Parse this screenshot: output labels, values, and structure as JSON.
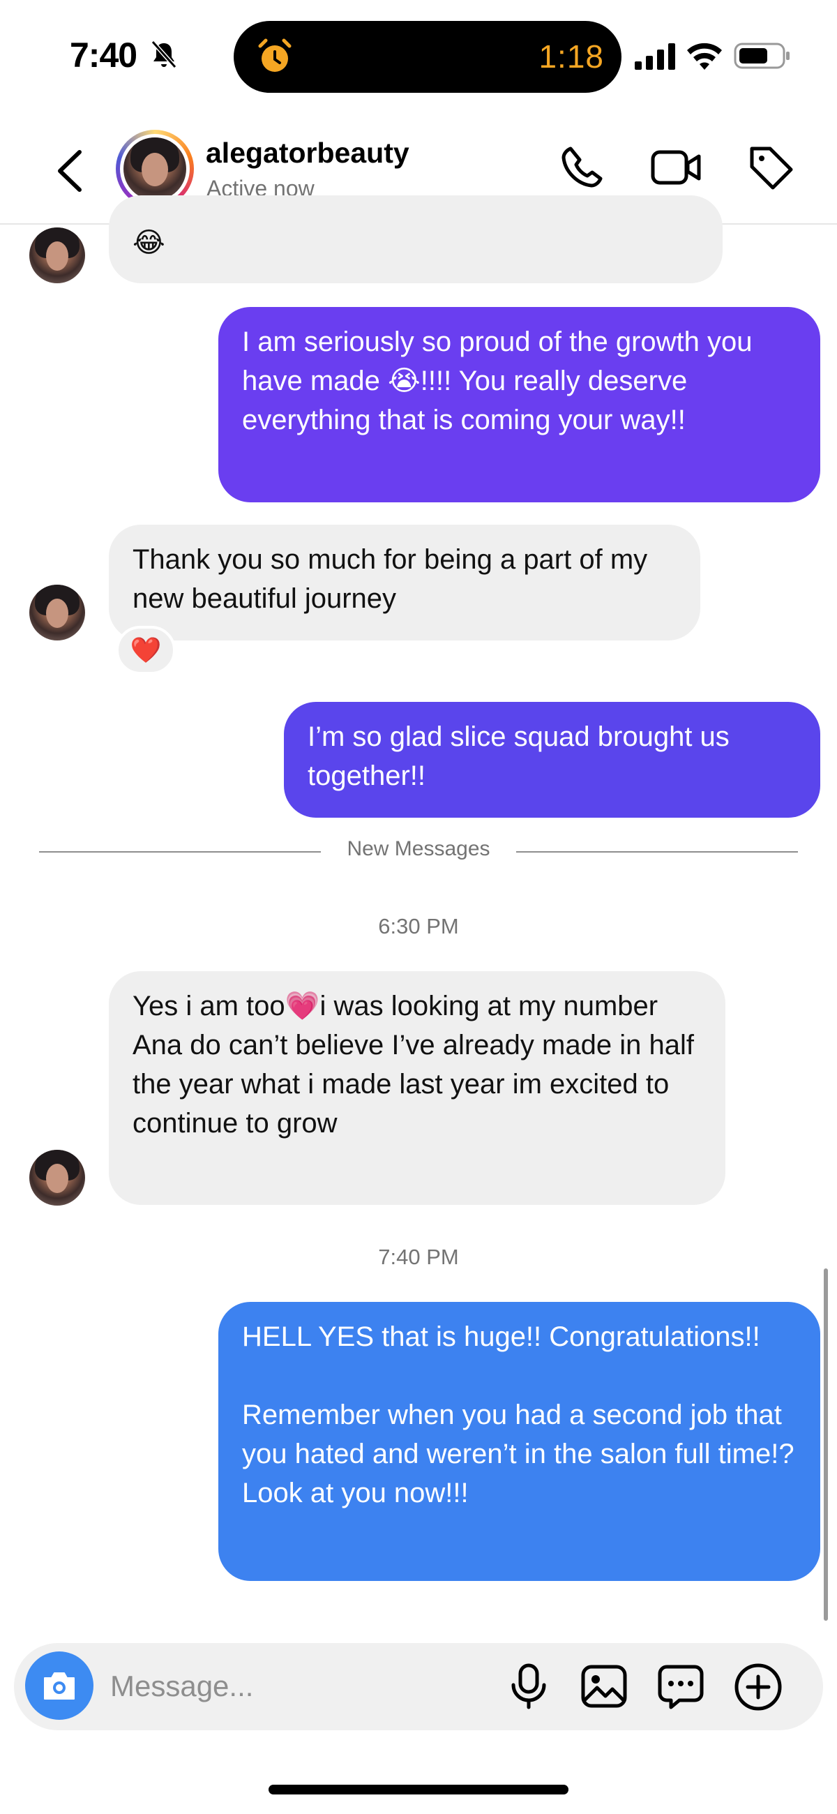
{
  "status_bar": {
    "time": "7:40",
    "timer": "1:18",
    "icons": [
      "bell-slash-icon",
      "alarm-icon",
      "signal-icon",
      "wifi-icon",
      "battery-icon"
    ]
  },
  "header": {
    "username": "alegatorbeauty",
    "status": "Active now",
    "icons": [
      "back-icon",
      "phone-icon",
      "video-icon",
      "tag-icon"
    ]
  },
  "messages": [
    {
      "sender": "them",
      "text": "😂"
    },
    {
      "sender": "me",
      "text": "I am seriously so proud of the growth you have made 😭!!!! You really deserve everything that is coming your way!!"
    },
    {
      "sender": "them",
      "text": "Thank you so much for being a part of my new beautiful journey",
      "reaction": "❤️"
    },
    {
      "sender": "me",
      "text": "I’m so glad slice squad brought us together!!"
    },
    {
      "sender": "them",
      "text": "Yes i am too💗i was looking at my number Ana do can’t believe I’ve already made in half the year what i made last year im excited to continue to grow"
    },
    {
      "sender": "me",
      "text": "HELL YES that is huge!! Congratulations!!\n\nRemember when you had a second job that you hated and weren’t in the salon full time!? Look at you now!!!"
    }
  ],
  "divider": {
    "label": "New Messages"
  },
  "timestamps": [
    "6:30 PM",
    "7:40 PM"
  ],
  "composer": {
    "placeholder": "Message...",
    "icons": [
      "camera-icon",
      "microphone-icon",
      "gallery-icon",
      "sticker-icon",
      "plus-icon"
    ]
  },
  "colors": {
    "outgoing_purple": "#6a3ef0",
    "outgoing_indigo": "#5a45ec",
    "outgoing_blue": "#3d82f0",
    "incoming_gray": "#efefef",
    "accent_blue": "#3d8bf2",
    "timer_orange": "#f5a623"
  }
}
